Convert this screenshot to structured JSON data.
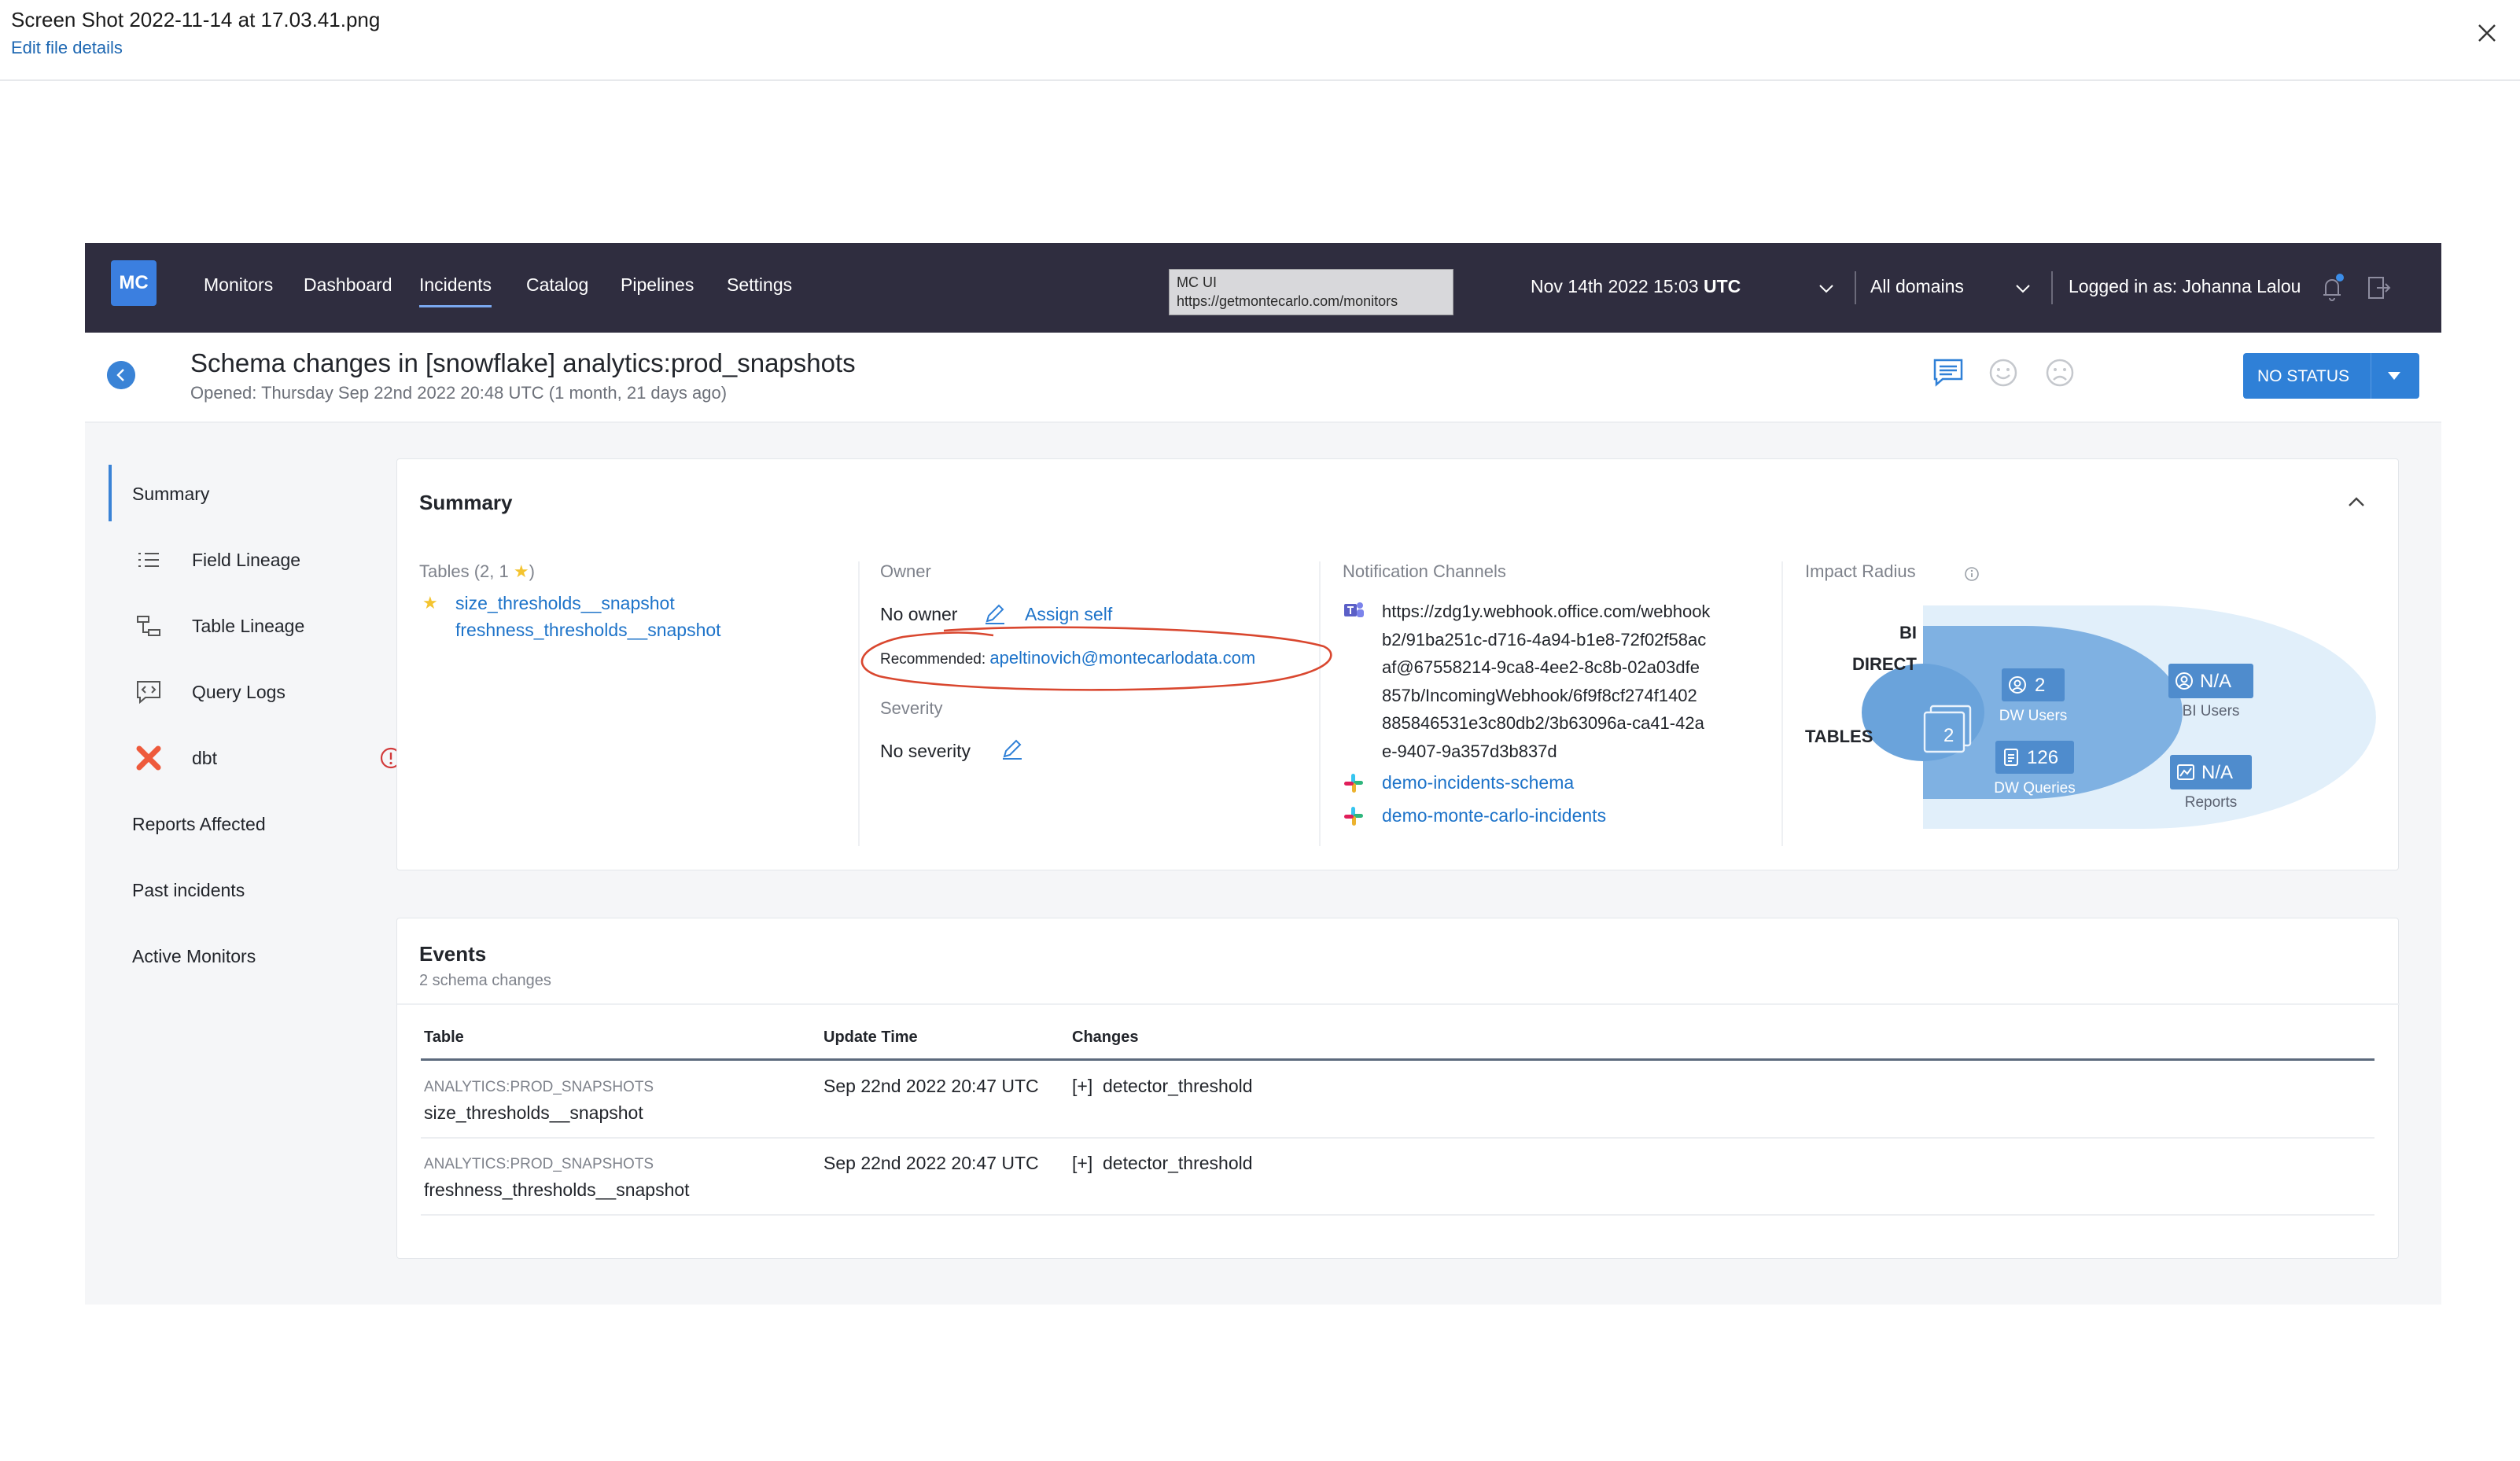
{
  "viewer": {
    "file_title": "Screen Shot 2022-11-14 at 17.03.41.png",
    "edit_label": "Edit file details"
  },
  "topbar": {
    "logo": "MC",
    "nav": [
      "Monitors",
      "Dashboard",
      "Incidents",
      "Catalog",
      "Pipelines",
      "Settings"
    ],
    "active_nav": "Incidents",
    "env_name": "MC UI",
    "env_url": "https://getmontecarlo.com/monitors",
    "date_text": "Nov 14th 2022 15:03",
    "date_tz": "UTC",
    "domain": "All domains",
    "login": "Logged in as: Johanna Lalou"
  },
  "incident": {
    "title": "Schema changes in [snowflake] analytics:prod_snapshots",
    "opened": "Opened: Thursday Sep 22nd 2022 20:48 UTC (1 month, 21 days ago)",
    "status_label": "NO STATUS"
  },
  "sidenav": {
    "items": [
      "Summary",
      "Field Lineage",
      "Table Lineage",
      "Query Logs",
      "dbt",
      "Reports Affected",
      "Past incidents",
      "Active Monitors"
    ]
  },
  "summary": {
    "title": "Summary",
    "tables_label_prefix": "Tables (2, 1",
    "tables_label_suffix": ")",
    "tables": [
      "size_thresholds__snapshot",
      "freshness_thresholds__snapshot"
    ],
    "owner_label": "Owner",
    "owner_value": "No owner",
    "assign_self": "Assign self",
    "recommended_label": "Recommended:",
    "recommended_email": "apeltinovich@montecarlodata.com",
    "severity_label": "Severity",
    "severity_value": "No severity",
    "notification_label": "Notification Channels",
    "webhook_lines": [
      "https://zdg1y.webhook.office.com/webhook",
      "b2/91ba251c-d716-4a94-b1e8-72f02f58ac",
      "af@67558214-9ca8-4ee2-8c8b-02a03dfe",
      "857b/IncomingWebhook/6f9f8cf274f1402",
      "885846531e3c80db2/3b63096a-ca41-42a",
      "e-9407-9a357d3b837d"
    ],
    "slack_channels": [
      "demo-incidents-schema",
      "demo-monte-carlo-incidents"
    ],
    "impact_label": "Impact Radius",
    "impact": {
      "bi_label": "BI",
      "direct_label": "DIRECT",
      "tables_label": "TABLES",
      "tables_count": "2",
      "dw_users_value": "2",
      "dw_users_label": "DW Users",
      "dw_queries_value": "126",
      "dw_queries_label": "DW Queries",
      "bi_users_value": "N/A",
      "bi_users_label": "BI Users",
      "reports_value": "N/A",
      "reports_label": "Reports"
    }
  },
  "events": {
    "title": "Events",
    "subtitle": "2 schema changes",
    "columns": [
      "Table",
      "Update Time",
      "Changes"
    ],
    "rows": [
      {
        "schema": "ANALYTICS:PROD_SNAPSHOTS",
        "table": "size_thresholds__snapshot",
        "time": "Sep 22nd 2022 20:47 UTC",
        "change": "[+]  detector_threshold"
      },
      {
        "schema": "ANALYTICS:PROD_SNAPSHOTS",
        "table": "freshness_thresholds__snapshot",
        "time": "Sep 22nd 2022 20:47 UTC",
        "change": "[+]  detector_threshold"
      }
    ]
  },
  "colors": {
    "topbar": "#2f2d3f",
    "accent": "#2f80d7",
    "link": "#1d73c9",
    "annotation": "#d9472f"
  }
}
